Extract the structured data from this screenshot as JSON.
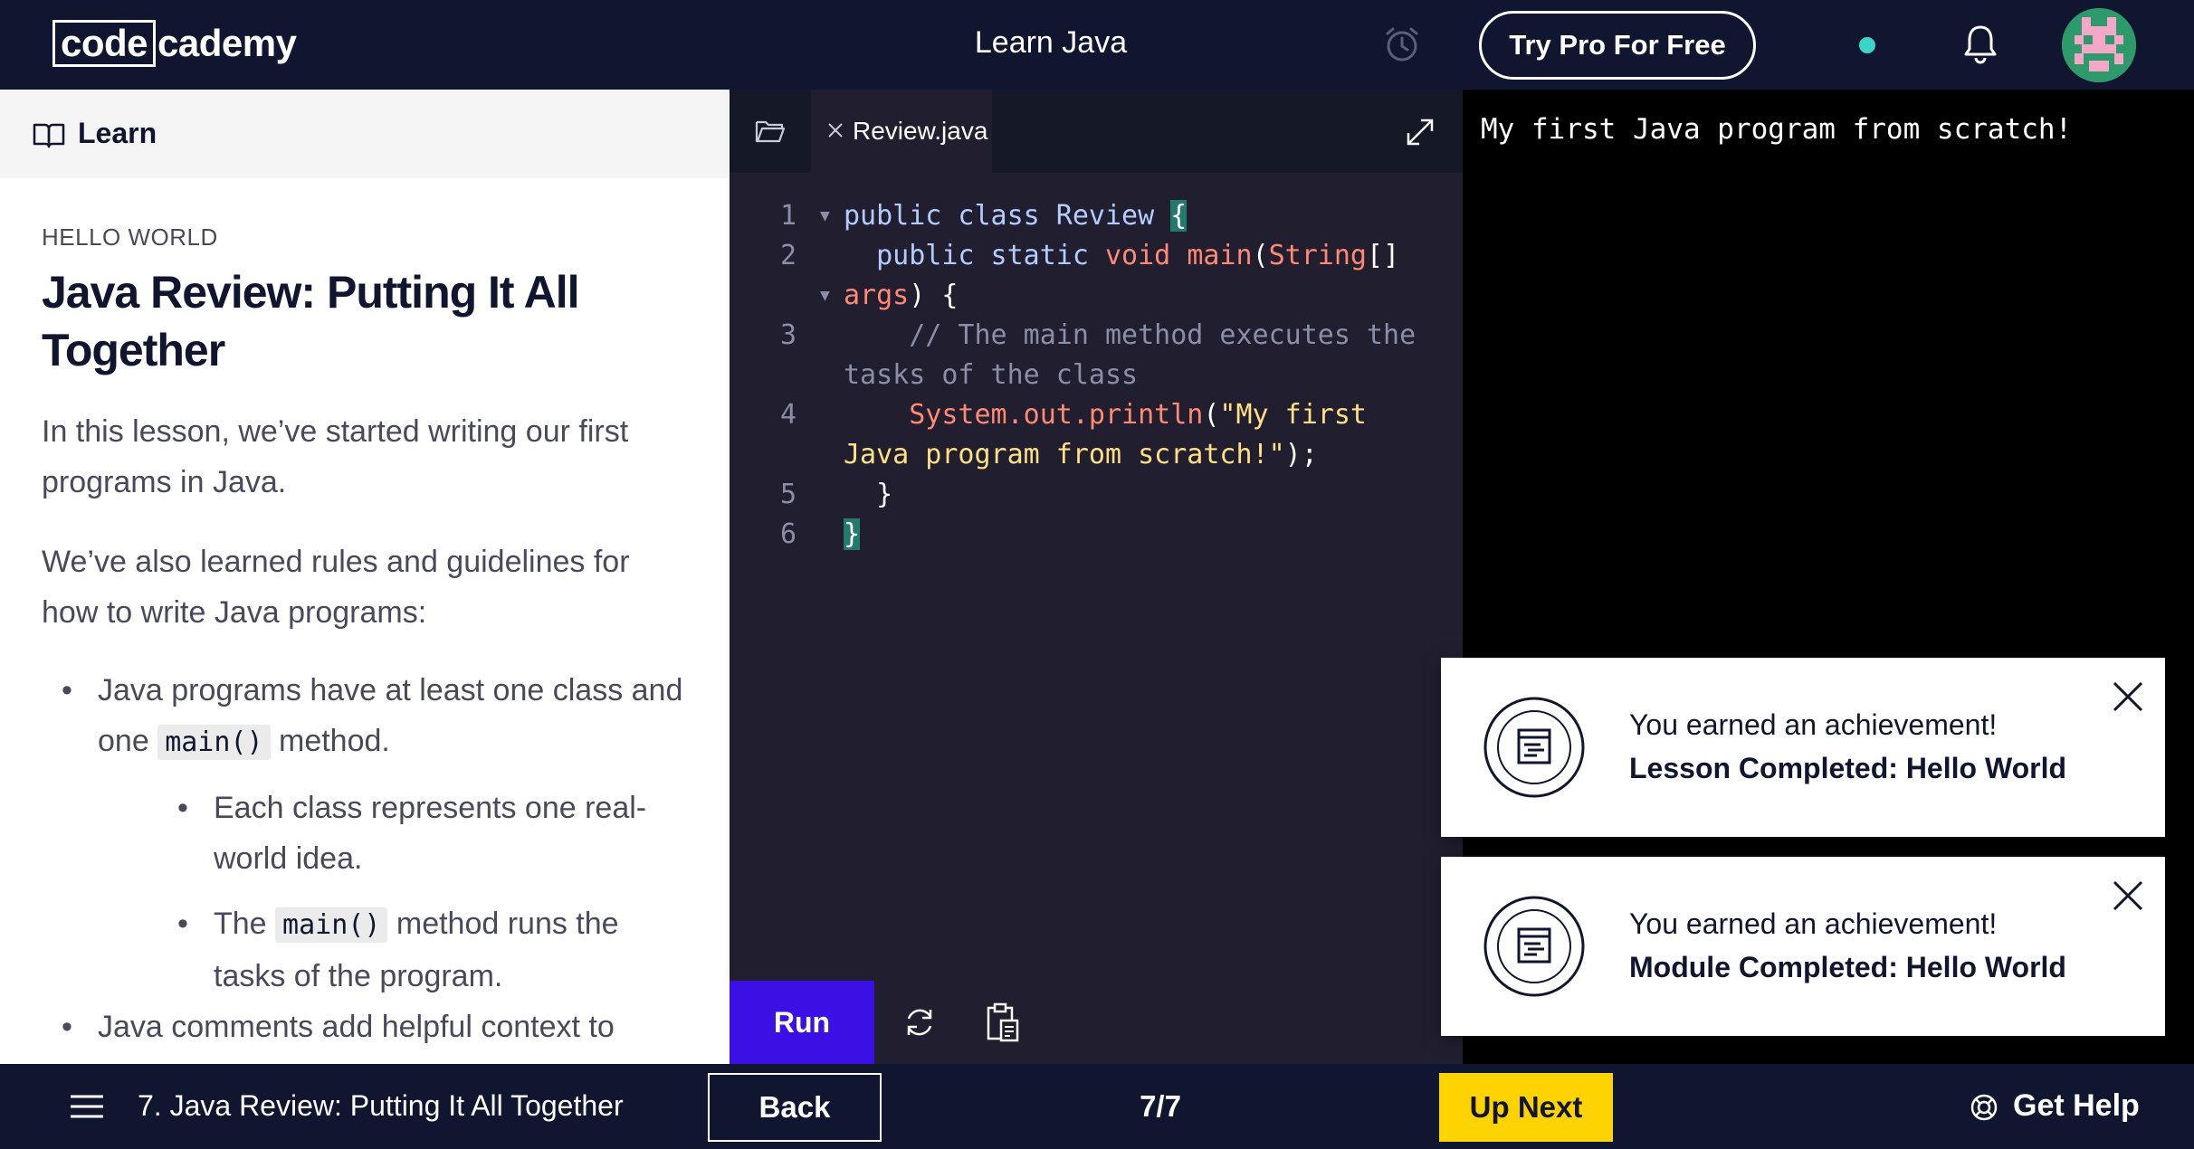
{
  "header": {
    "logo_code": "code",
    "logo_rest": "cademy",
    "course_title": "Learn Java",
    "try_pro_label": "Try Pro For Free"
  },
  "learn": {
    "header_label": "Learn",
    "eyebrow": "HELLO WORLD",
    "title": "Java Review: Putting It All Together",
    "paragraphs": [
      "In this lesson, we’ve started writing our first programs in Java.",
      "We’ve also learned rules and guidelines for how to write Java programs:"
    ],
    "bullet1_before": "Java programs have at least one class and one ",
    "bullet1_code": "main()",
    "bullet1_after": " method.",
    "sub1": "Each class represents one real-world idea.",
    "sub2_before": "The ",
    "sub2_code": "main()",
    "sub2_after": " method runs the tasks of the program.",
    "bullet2": "Java comments add helpful context to"
  },
  "editor": {
    "file_tab": "Review.java",
    "line_numbers": [
      "1",
      "2",
      "3",
      "4",
      "5",
      "6"
    ],
    "lines": {
      "l1_kw": "public class Review ",
      "l1_brace": "{",
      "l2_indent": "  ",
      "l2_kw": "public static ",
      "l2_type": "void ",
      "l2_method": "main",
      "l2_paren": "(",
      "l2_param_type": "String",
      "l2_rest": "[]",
      "l2_args": "args",
      "l2_end": ") {",
      "l3_comment": "    // The main method executes the tasks of the class",
      "l4_indent": "    ",
      "l4_call": "System.out.println",
      "l4_open": "(",
      "l4_str": "\"My first Java program from scratch!\"",
      "l4_close": ");",
      "l5": "  }",
      "l6": "}"
    },
    "run_label": "Run"
  },
  "output": {
    "text": "My first Java program from scratch!"
  },
  "toasts": [
    {
      "line1": "You earned an achievement!",
      "line2": "Lesson Completed: Hello World"
    },
    {
      "line1": "You earned an achievement!",
      "line2": "Module Completed: Hello World"
    }
  ],
  "footer": {
    "lesson_name": "7. Java Review: Putting It All Together",
    "back_label": "Back",
    "pager": "7/7",
    "up_next_label": "Up Next",
    "help_label": "Get Help"
  },
  "colors": {
    "nav_bg": "#10162f",
    "editor_bg": "#211e2f",
    "run_button": "#3a10e5",
    "up_next": "#ffd300",
    "status_dot": "#3bd4c9",
    "brace_highlight": "#217a6c"
  },
  "icons": [
    "alarm-clock-icon",
    "bell-icon",
    "book-icon",
    "folder-icon",
    "close-icon",
    "expand-icon",
    "refresh-icon",
    "clipboard-icon",
    "achievement-badge-icon",
    "menu-icon",
    "help-icon"
  ]
}
